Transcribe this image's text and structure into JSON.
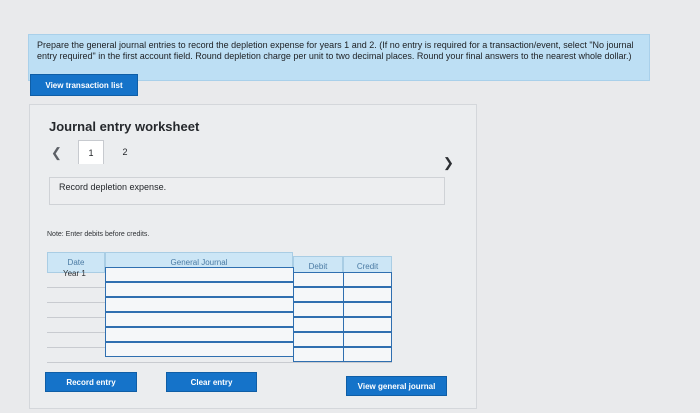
{
  "instructions": {
    "text": "Prepare the general journal entries to record the depletion expense for years 1 and 2. (If no entry is required for a transaction/event, select \"No journal entry required\" in the first account field. Round depletion charge per unit to two decimal places. Round your final answers to the nearest whole dollar.)"
  },
  "buttons": {
    "view_transaction_list": "View transaction list",
    "record_entry": "Record entry",
    "clear_entry": "Clear entry",
    "view_general_journal": "View general journal"
  },
  "worksheet": {
    "title": "Journal entry worksheet",
    "tabs": [
      {
        "label": "1"
      },
      {
        "label": "2"
      }
    ],
    "task": "Record depletion expense.",
    "note": "Note: Enter debits before credits."
  },
  "table": {
    "headers": {
      "date": "Date",
      "general_journal": "General Journal",
      "debit": "Debit",
      "credit": "Credit"
    },
    "rows": [
      {
        "date": "Year 1",
        "account": "",
        "debit": "",
        "credit": ""
      },
      {
        "date": "",
        "account": "",
        "debit": "",
        "credit": ""
      },
      {
        "date": "",
        "account": "",
        "debit": "",
        "credit": ""
      },
      {
        "date": "",
        "account": "",
        "debit": "",
        "credit": ""
      },
      {
        "date": "",
        "account": "",
        "debit": "",
        "credit": ""
      },
      {
        "date": "",
        "account": "",
        "debit": "",
        "credit": ""
      }
    ]
  },
  "icons": {
    "prev": "chevron-left-icon",
    "next": "chevron-right-icon"
  },
  "colors": {
    "accent": "#1573c9",
    "instructions_bg": "#bddff4",
    "table_header_bg": "#cce6f6",
    "page_bg": "#e9eaec"
  }
}
